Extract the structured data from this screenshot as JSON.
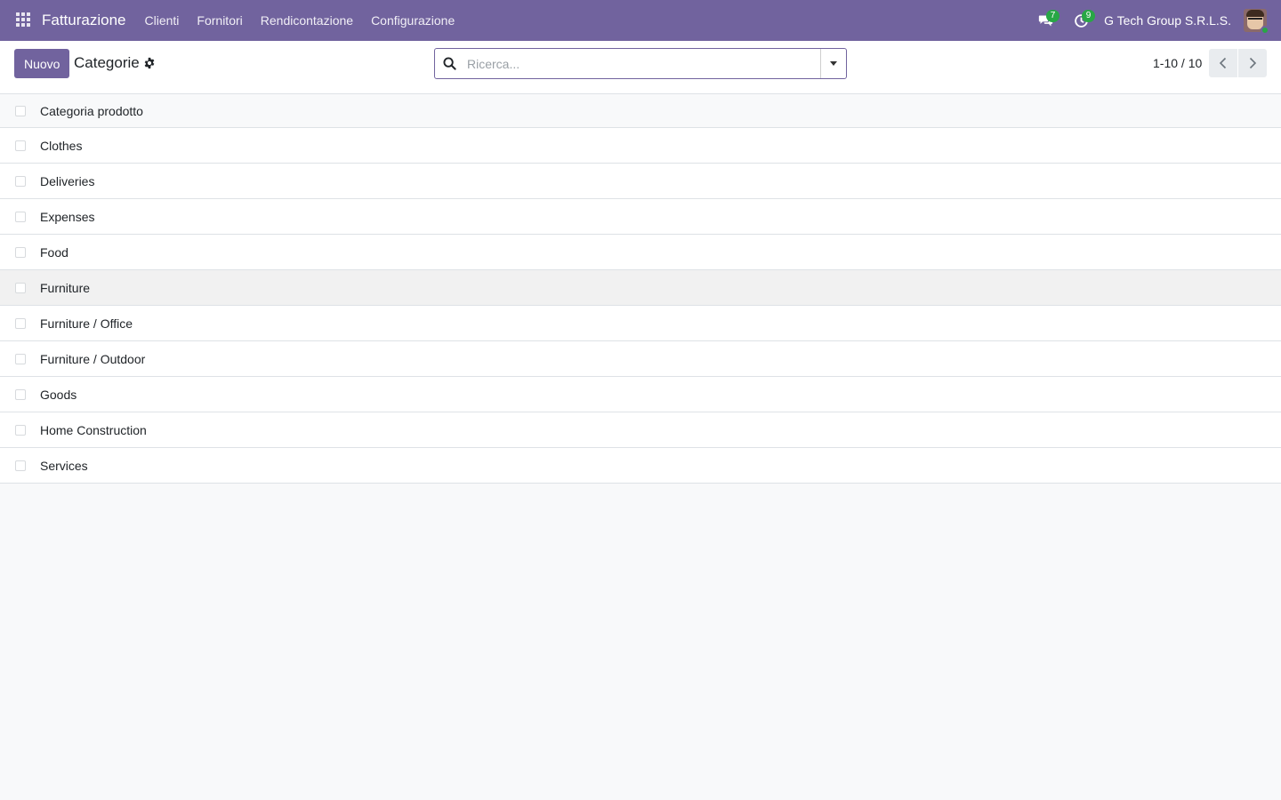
{
  "navbar": {
    "app_name": "Fatturazione",
    "menu": [
      "Clienti",
      "Fornitori",
      "Rendicontazione",
      "Configurazione"
    ],
    "messages_badge": "7",
    "activities_badge": "9",
    "company": "G Tech Group S.R.L.S.",
    "accent_color": "#71639e"
  },
  "control_panel": {
    "new_button": "Nuovo",
    "title": "Categorie",
    "search_placeholder": "Ricerca...",
    "pager_value": "1-10 / 10"
  },
  "list": {
    "column_header": "Categoria prodotto",
    "rows": [
      "Clothes",
      "Deliveries",
      "Expenses",
      "Food",
      "Furniture",
      "Furniture / Office",
      "Furniture / Outdoor",
      "Goods",
      "Home Construction",
      "Services"
    ]
  }
}
